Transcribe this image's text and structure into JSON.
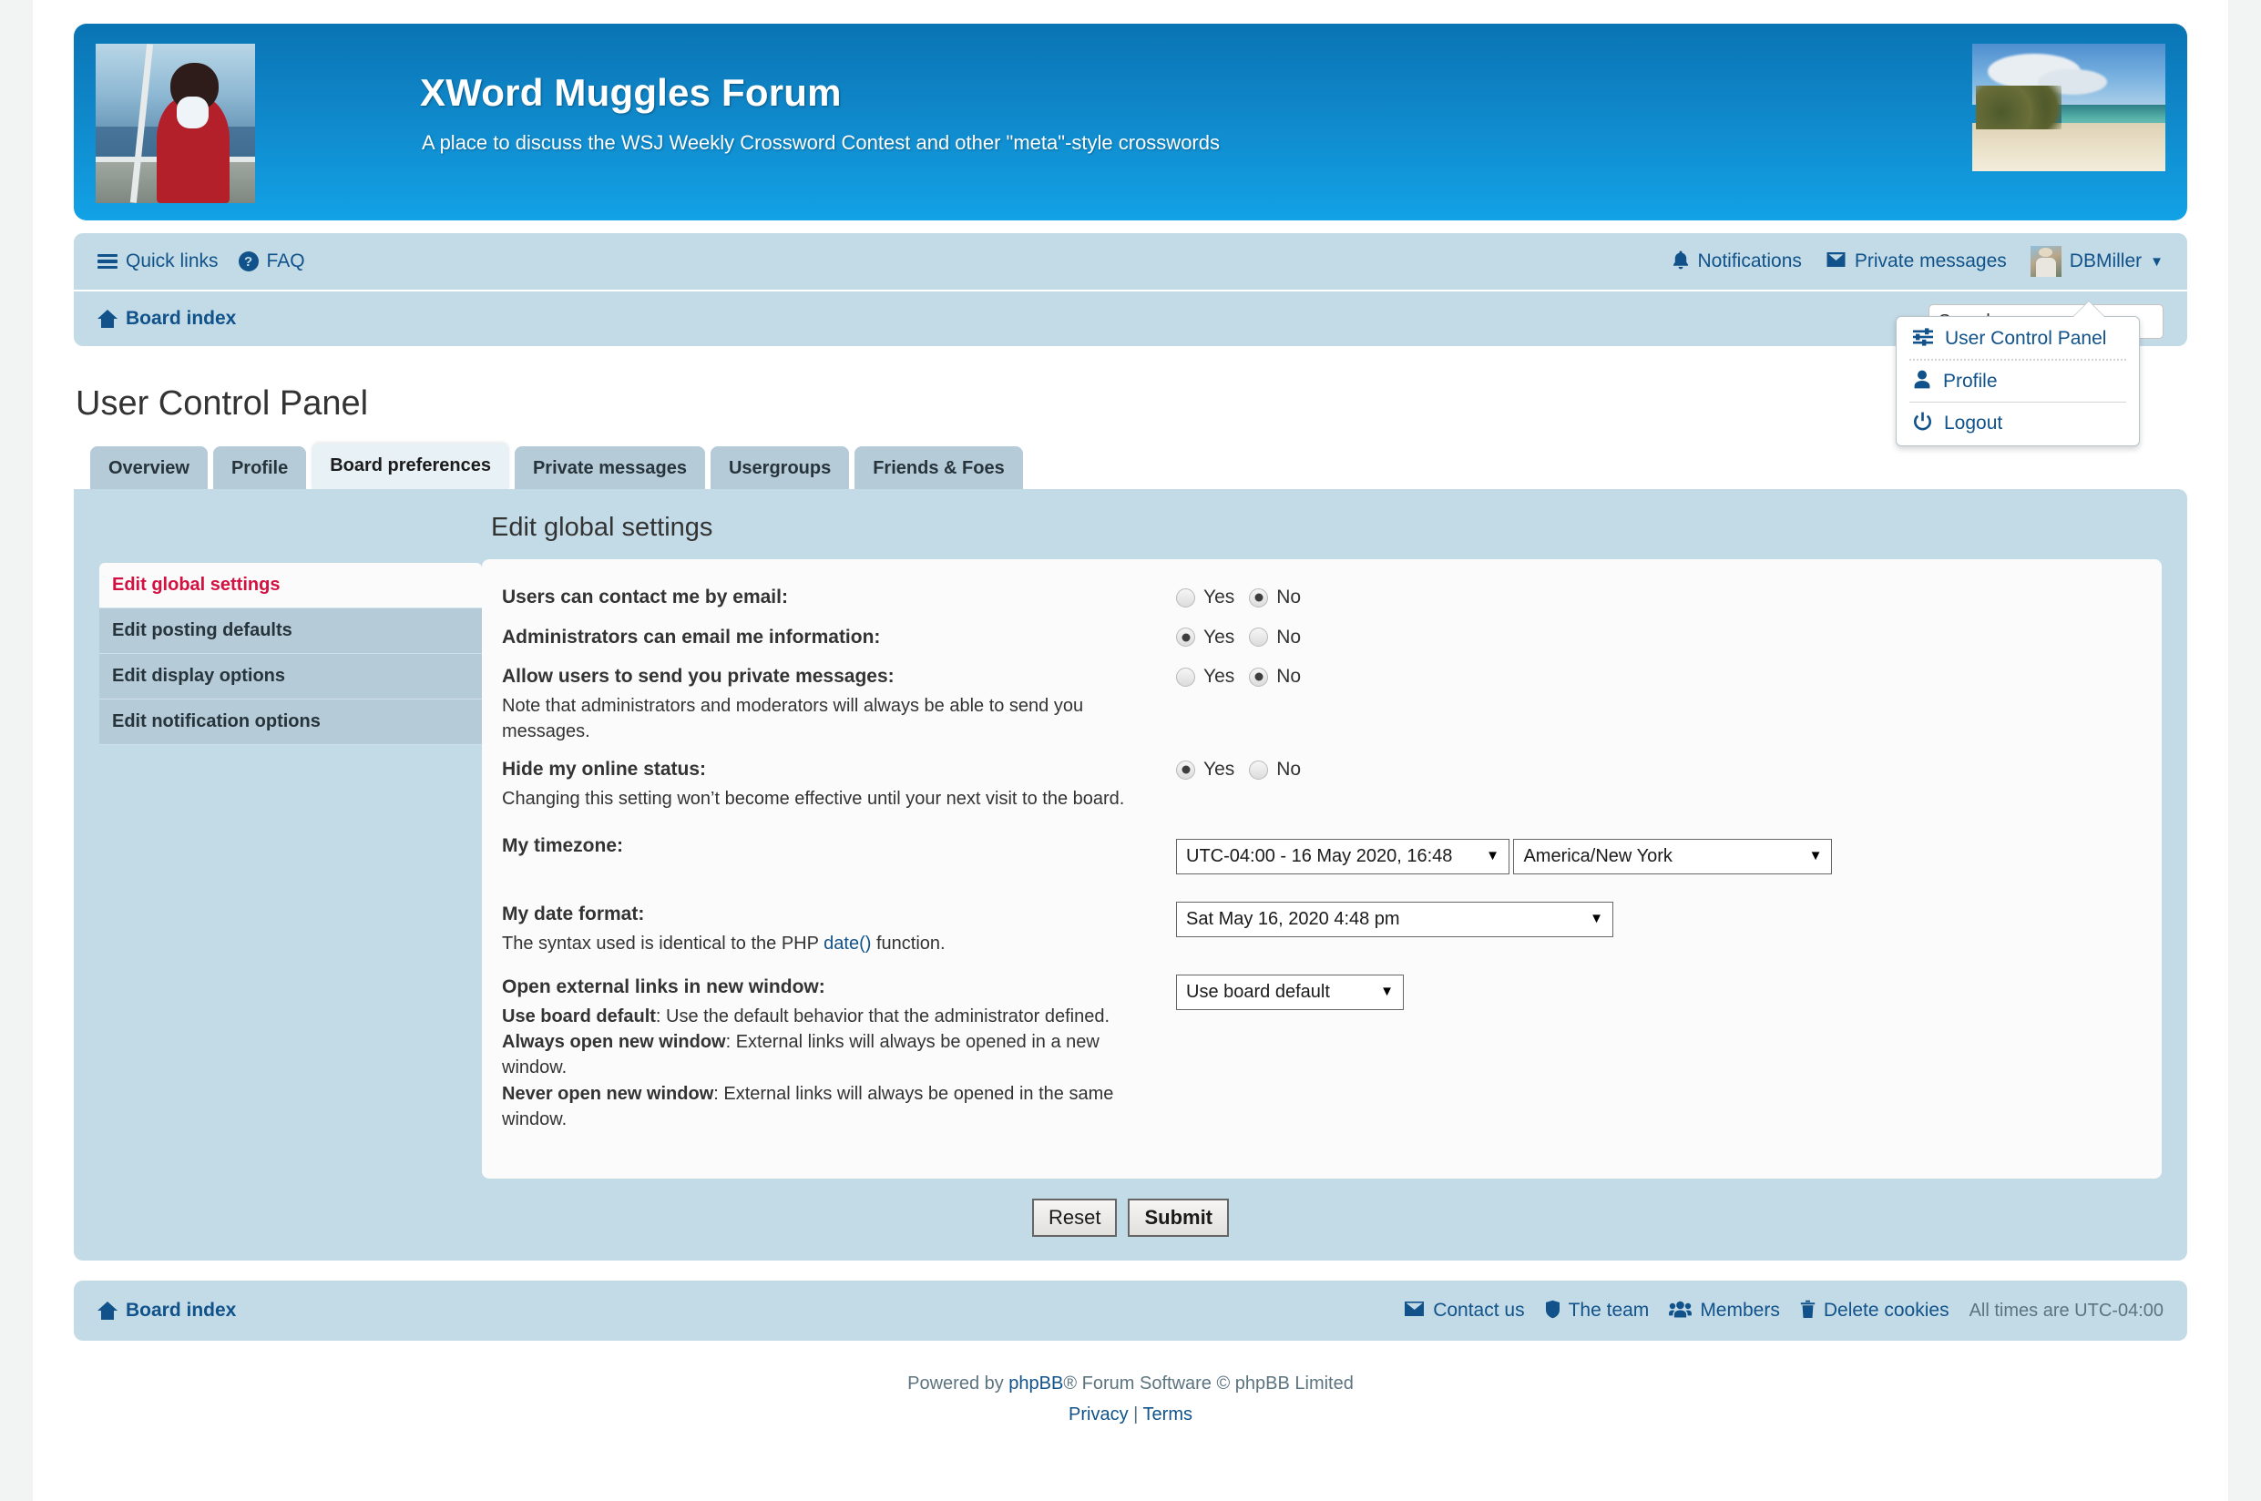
{
  "banner": {
    "title": "XWord Muggles Forum",
    "subtitle": "A place to discuss the WSJ Weekly Crossword Contest and other \"meta\"-style crosswords",
    "left_image_name": "cruise-photographer-photo",
    "right_image_name": "tropical-beach-photo"
  },
  "navbar": {
    "quick_links": "Quick links",
    "faq": "FAQ",
    "notifications": "Notifications",
    "private_messages": "Private messages",
    "username": "DBMiller",
    "board_index": "Board index",
    "search_placeholder": "Search…",
    "search_value": "Search…"
  },
  "user_menu": {
    "items": [
      {
        "label": "User Control Panel",
        "icon": "sliders-icon"
      },
      {
        "label": "Profile",
        "icon": "user-icon"
      },
      {
        "label": "Logout",
        "icon": "power-icon"
      }
    ]
  },
  "page": {
    "title": "User Control Panel"
  },
  "tabs": [
    {
      "label": "Overview",
      "active": false
    },
    {
      "label": "Profile",
      "active": false
    },
    {
      "label": "Board preferences",
      "active": true
    },
    {
      "label": "Private messages",
      "active": false
    },
    {
      "label": "Usergroups",
      "active": false
    },
    {
      "label": "Friends & Foes",
      "active": false
    }
  ],
  "panel": {
    "heading": "Edit global settings"
  },
  "side_nav": [
    {
      "label": "Edit global settings",
      "active": true
    },
    {
      "label": "Edit posting defaults",
      "active": false
    },
    {
      "label": "Edit display options",
      "active": false
    },
    {
      "label": "Edit notification options",
      "active": false
    }
  ],
  "settings": {
    "contact_email": {
      "label": "Users can contact me by email:",
      "yes": "Yes",
      "no": "No",
      "value": "No"
    },
    "admin_email": {
      "label": "Administrators can email me information:",
      "yes": "Yes",
      "no": "No",
      "value": "Yes"
    },
    "allow_pm": {
      "label": "Allow users to send you private messages:",
      "desc": "Note that administrators and moderators will always be able to send you messages.",
      "yes": "Yes",
      "no": "No",
      "value": "No"
    },
    "hide_online": {
      "label": "Hide my online status:",
      "desc": "Changing this setting won’t become effective until your next visit to the board.",
      "yes": "Yes",
      "no": "No",
      "value": "Yes"
    },
    "timezone": {
      "label": "My timezone:",
      "offset_value": "UTC-04:00 - 16 May 2020, 16:48",
      "zone_value": "America/New York"
    },
    "date_format": {
      "label": "My date format:",
      "desc_pre": "The syntax used is identical to the PHP ",
      "desc_link": "date()",
      "desc_post": " function.",
      "value": "Sat May 16, 2020 4:48 pm"
    },
    "external_links": {
      "label": "Open external links in new window:",
      "opt1_name": "Use board default",
      "opt1_desc": ": Use the default behavior that the administrator defined.",
      "opt2_name": "Always open new window",
      "opt2_desc": ": External links will always be opened in a new window.",
      "opt3_name": "Never open new window",
      "opt3_desc": ": External links will always be opened in the same window.",
      "value": "Use board default"
    },
    "buttons": {
      "reset": "Reset",
      "submit": "Submit"
    }
  },
  "footer": {
    "board_index": "Board index",
    "contact_us": "Contact us",
    "the_team": "The team",
    "members": "Members",
    "delete_cookies": "Delete cookies",
    "all_times": "All times are UTC-04:00",
    "credit_pre": "Powered by ",
    "credit_link": "phpBB",
    "credit_post": "® Forum Software © phpBB Limited",
    "privacy": "Privacy",
    "separator": "|",
    "terms": "Terms"
  }
}
